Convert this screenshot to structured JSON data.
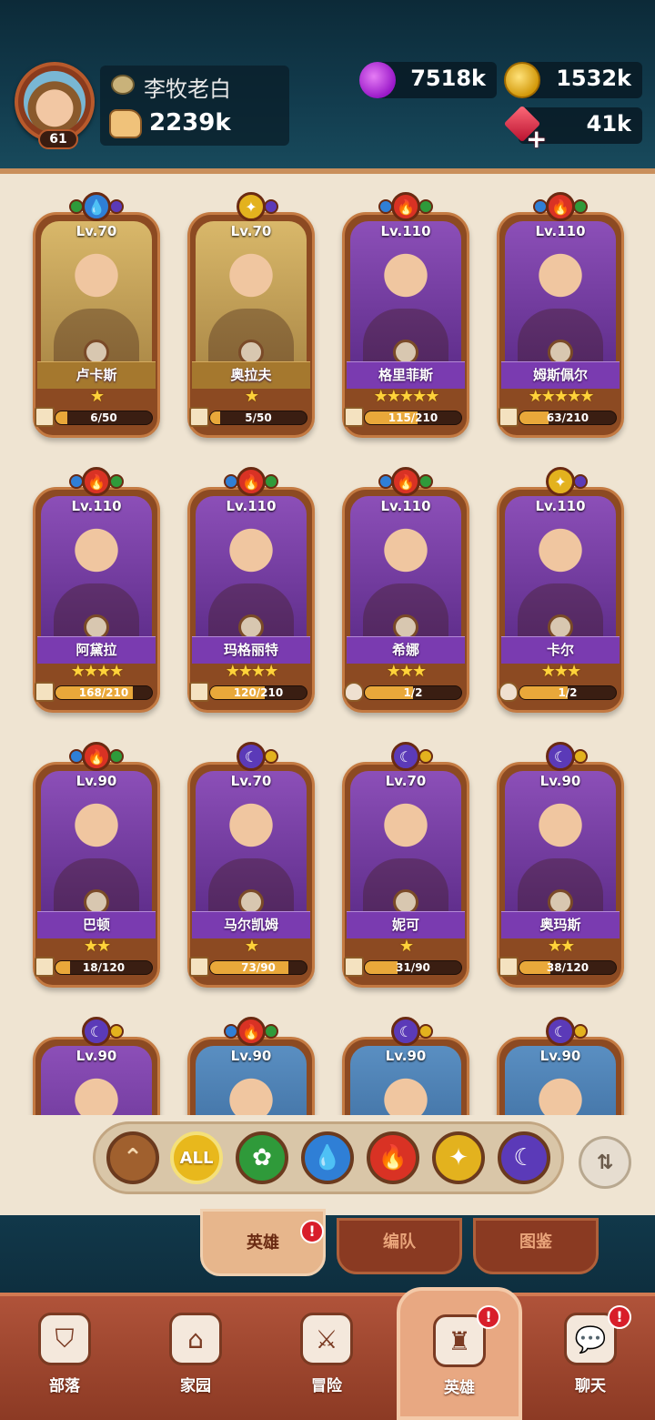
{
  "player": {
    "name": "李牧老白",
    "level": "61",
    "power": "2239k"
  },
  "resources": {
    "potion": "7518k",
    "coins": "1532k",
    "gems": "41k"
  },
  "heroes": [
    {
      "level": "Lv.70",
      "name": "卢卡斯",
      "stars": "★",
      "progress": "6/50",
      "progress_fraction": 0.12,
      "element": "water",
      "side_left": "nature",
      "side_right": "dark",
      "art": "gold",
      "banner": "gold",
      "shard": "piece"
    },
    {
      "level": "Lv.70",
      "name": "奥拉夫",
      "stars": "★",
      "progress": "5/50",
      "progress_fraction": 0.1,
      "element": "light",
      "side_left": "",
      "side_right": "dark",
      "art": "gold",
      "banner": "gold",
      "shard": "piece"
    },
    {
      "level": "Lv.110",
      "name": "格里菲斯",
      "stars": "★★★★★",
      "progress": "115/210",
      "progress_fraction": 0.55,
      "element": "fire",
      "side_left": "water",
      "side_right": "nature",
      "art": "purple",
      "banner": "purple",
      "shard": "piece"
    },
    {
      "level": "Lv.110",
      "name": "姆斯佩尔",
      "stars": "★★★★★",
      "progress": "63/210",
      "progress_fraction": 0.3,
      "element": "fire",
      "side_left": "water",
      "side_right": "nature",
      "art": "purple",
      "banner": "purple",
      "shard": "piece"
    },
    {
      "level": "Lv.110",
      "name": "阿黛拉",
      "stars": "★★★★",
      "progress": "168/210",
      "progress_fraction": 0.8,
      "element": "fire",
      "side_left": "water",
      "side_right": "nature",
      "art": "purple",
      "banner": "purple",
      "shard": "piece"
    },
    {
      "level": "Lv.110",
      "name": "玛格丽特",
      "stars": "★★★★",
      "progress": "120/210",
      "progress_fraction": 0.57,
      "element": "fire",
      "side_left": "water",
      "side_right": "nature",
      "art": "purple",
      "banner": "purple",
      "shard": "piece"
    },
    {
      "level": "Lv.110",
      "name": "希娜",
      "stars": "★★★",
      "progress": "1/2",
      "progress_fraction": 0.5,
      "element": "fire",
      "side_left": "water",
      "side_right": "nature",
      "art": "purple",
      "banner": "purple",
      "shard": "horn"
    },
    {
      "level": "Lv.110",
      "name": "卡尔",
      "stars": "★★★",
      "progress": "1/2",
      "progress_fraction": 0.5,
      "element": "light",
      "side_left": "",
      "side_right": "dark",
      "art": "purple",
      "banner": "purple",
      "shard": "horn"
    },
    {
      "level": "Lv.90",
      "name": "巴顿",
      "stars": "★★",
      "progress": "18/120",
      "progress_fraction": 0.15,
      "element": "fire",
      "side_left": "water",
      "side_right": "nature",
      "art": "purple",
      "banner": "purple",
      "shard": "piece"
    },
    {
      "level": "Lv.70",
      "name": "马尔凯姆",
      "stars": "★",
      "progress": "73/90",
      "progress_fraction": 0.81,
      "element": "dark",
      "side_left": "",
      "side_right": "light",
      "art": "purple",
      "banner": "purple",
      "shard": "piece"
    },
    {
      "level": "Lv.70",
      "name": "妮可",
      "stars": "★",
      "progress": "31/90",
      "progress_fraction": 0.34,
      "element": "dark",
      "side_left": "",
      "side_right": "light",
      "art": "purple",
      "banner": "purple",
      "shard": "piece"
    },
    {
      "level": "Lv.90",
      "name": "奥玛斯",
      "stars": "★★",
      "progress": "38/120",
      "progress_fraction": 0.32,
      "element": "dark",
      "side_left": "",
      "side_right": "light",
      "art": "purple",
      "banner": "purple",
      "shard": "piece"
    },
    {
      "level": "Lv.90",
      "name": "",
      "stars": "",
      "progress": "",
      "progress_fraction": 0,
      "element": "dark",
      "side_left": "",
      "side_right": "light",
      "art": "purple",
      "banner": "purple",
      "shard": "piece"
    },
    {
      "level": "Lv.90",
      "name": "",
      "stars": "",
      "progress": "",
      "progress_fraction": 0,
      "element": "fire",
      "side_left": "water",
      "side_right": "nature",
      "art": "blue",
      "banner": "purple",
      "shard": "piece"
    },
    {
      "level": "Lv.90",
      "name": "",
      "stars": "",
      "progress": "",
      "progress_fraction": 0,
      "element": "dark",
      "side_left": "",
      "side_right": "light",
      "art": "blue",
      "banner": "purple",
      "shard": "piece"
    },
    {
      "level": "Lv.90",
      "name": "",
      "stars": "",
      "progress": "",
      "progress_fraction": 0,
      "element": "dark",
      "side_left": "",
      "side_right": "light",
      "art": "blue",
      "banner": "purple",
      "shard": "piece"
    }
  ],
  "filters": {
    "all_label": "ALL",
    "items": [
      "sort-up",
      "all",
      "nature",
      "water",
      "fire",
      "light",
      "dark"
    ],
    "selected": "all"
  },
  "subtabs": [
    {
      "label": "英雄",
      "active": true,
      "alert": "!"
    },
    {
      "label": "编队",
      "active": false,
      "alert": ""
    },
    {
      "label": "图鉴",
      "active": false,
      "alert": ""
    }
  ],
  "nav": [
    {
      "label": "部落",
      "icon": "tribe-icon",
      "active": false,
      "alert": ""
    },
    {
      "label": "家园",
      "icon": "home-icon",
      "active": false,
      "alert": ""
    },
    {
      "label": "冒险",
      "icon": "swords-icon",
      "active": false,
      "alert": ""
    },
    {
      "label": "英雄",
      "icon": "viking-helmet-icon",
      "active": true,
      "alert": "!"
    },
    {
      "label": "聊天",
      "icon": "chat-icon",
      "active": false,
      "alert": "!"
    }
  ],
  "colors": {
    "water": "#2f7fd6",
    "fire": "#d93224",
    "light": "#e3b21e",
    "dark": "#5b3ab8",
    "nature": "#2f9a3a"
  }
}
